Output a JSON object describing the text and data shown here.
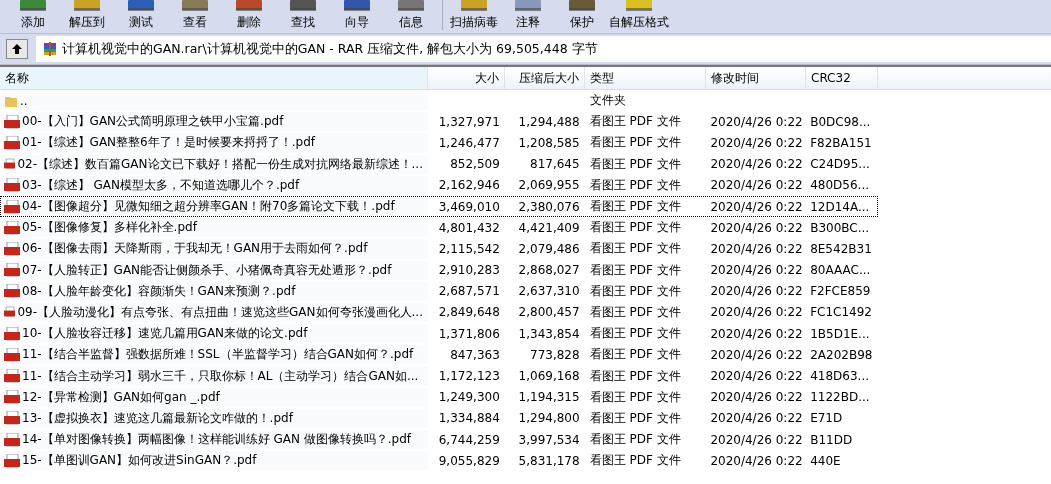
{
  "toolbar": [
    {
      "label": "添加",
      "kind": "add"
    },
    {
      "label": "解压到",
      "kind": "extract"
    },
    {
      "label": "测试",
      "kind": "test"
    },
    {
      "label": "查看",
      "kind": "view"
    },
    {
      "label": "删除",
      "kind": "delete"
    },
    {
      "label": "查找",
      "kind": "find"
    },
    {
      "label": "向导",
      "kind": "wizard"
    },
    {
      "label": "信息",
      "kind": "info"
    },
    {
      "label": "扫描病毒",
      "kind": "scan",
      "separator_before": true
    },
    {
      "label": "注释",
      "kind": "comment"
    },
    {
      "label": "保护",
      "kind": "protect"
    },
    {
      "label": "自解压格式",
      "kind": "sfx"
    }
  ],
  "address": {
    "path": "计算机视觉中的GAN.rar\\计算机视觉中的GAN - RAR 压缩文件, 解包大小为 69,505,448 字节"
  },
  "table": {
    "columns": [
      "名称",
      "大小",
      "压缩后大小",
      "类型",
      "修改时间",
      "CRC32"
    ],
    "rows": [
      {
        "kind": "folder",
        "name": "..",
        "size": "",
        "packed": "",
        "type": "文件夹",
        "modified": "",
        "crc": "",
        "focused": false
      },
      {
        "kind": "pdf",
        "name": "00-【入门】GAN公式简明原理之铁甲小宝篇.pdf",
        "size": "1,327,971",
        "packed": "1,294,488",
        "type": "看图王 PDF 文件",
        "modified": "2020/4/26 0:22",
        "crc": "B0DC98...",
        "focused": false
      },
      {
        "kind": "pdf",
        "name": "01-【综述】GAN整整6年了！是时候要来捋捋了！.pdf",
        "size": "1,246,477",
        "packed": "1,208,585",
        "type": "看图王 PDF 文件",
        "modified": "2020/4/26 0:22",
        "crc": "F82BA151",
        "focused": false
      },
      {
        "kind": "pdf",
        "name": "02-【综述】数百篇GAN论文已下载好！搭配一份生成对抗网络最新综述！...",
        "size": "852,509",
        "packed": "817,645",
        "type": "看图王 PDF 文件",
        "modified": "2020/4/26 0:22",
        "crc": "C24D95...",
        "focused": false
      },
      {
        "kind": "pdf",
        "name": "03-【综述】 GAN模型太多，不知道选哪儿个？.pdf",
        "size": "2,162,946",
        "packed": "2,069,955",
        "type": "看图王 PDF 文件",
        "modified": "2020/4/26 0:22",
        "crc": "480D56...",
        "focused": false
      },
      {
        "kind": "pdf",
        "name": "04-【图像超分】见微知细之超分辨率GAN！附70多篇论文下载！.pdf",
        "size": "3,469,010",
        "packed": "2,380,076",
        "type": "看图王 PDF 文件",
        "modified": "2020/4/26 0:22",
        "crc": "12D14A...",
        "focused": true
      },
      {
        "kind": "pdf",
        "name": "05-【图像修复】多样化补全.pdf",
        "size": "4,801,432",
        "packed": "4,421,409",
        "type": "看图王 PDF 文件",
        "modified": "2020/4/26 0:22",
        "crc": "B300BC...",
        "focused": false
      },
      {
        "kind": "pdf",
        "name": "06-【图像去雨】天降斯雨，于我却无！GAN用于去雨如何？.pdf",
        "size": "2,115,542",
        "packed": "2,079,486",
        "type": "看图王 PDF 文件",
        "modified": "2020/4/26 0:22",
        "crc": "8E542B31",
        "focused": false
      },
      {
        "kind": "pdf",
        "name": "07-【人脸转正】GAN能否让侧颜杀手、小猪佩奇真容无处遁形？.pdf",
        "size": "2,910,283",
        "packed": "2,868,027",
        "type": "看图王 PDF 文件",
        "modified": "2020/4/26 0:22",
        "crc": "80AAAC...",
        "focused": false
      },
      {
        "kind": "pdf",
        "name": "08-【人脸年龄变化】容颜渐失！GAN来预测？.pdf",
        "size": "2,687,571",
        "packed": "2,637,310",
        "type": "看图王 PDF 文件",
        "modified": "2020/4/26 0:22",
        "crc": "F2FCE859",
        "focused": false
      },
      {
        "kind": "pdf",
        "name": "09-【人脸动漫化】有点夸张、有点扭曲！速览这些GAN如何夸张漫画化人...",
        "size": "2,849,648",
        "packed": "2,800,457",
        "type": "看图王 PDF 文件",
        "modified": "2020/4/26 0:22",
        "crc": "FC1C1492",
        "focused": false
      },
      {
        "kind": "pdf",
        "name": "10-【人脸妆容迁移】速览几篇用GAN来做的论文.pdf",
        "size": "1,371,806",
        "packed": "1,343,854",
        "type": "看图王 PDF 文件",
        "modified": "2020/4/26 0:22",
        "crc": "1B5D1E...",
        "focused": false
      },
      {
        "kind": "pdf",
        "name": "11-【结合半监督】强数据所难！SSL（半监督学习）结合GAN如何？.pdf",
        "size": "847,363",
        "packed": "773,828",
        "type": "看图王 PDF 文件",
        "modified": "2020/4/26 0:22",
        "crc": "2A202B98",
        "focused": false
      },
      {
        "kind": "pdf",
        "name": "11-【结合主动学习】弱水三千，只取你标！AL（主动学习）结合GAN如...",
        "size": "1,172,123",
        "packed": "1,069,168",
        "type": "看图王 PDF 文件",
        "modified": "2020/4/26 0:22",
        "crc": "418D63...",
        "focused": false
      },
      {
        "kind": "pdf",
        "name": "12-【异常检测】GAN如何gan _.pdf",
        "size": "1,249,300",
        "packed": "1,194,315",
        "type": "看图王 PDF 文件",
        "modified": "2020/4/26 0:22",
        "crc": "1122BD...",
        "focused": false
      },
      {
        "kind": "pdf",
        "name": "13-【虚拟换衣】速览这几篇最新论文咋做的！.pdf",
        "size": "1,334,884",
        "packed": "1,294,800",
        "type": "看图王 PDF 文件",
        "modified": "2020/4/26 0:22",
        "crc": "E71D",
        "focused": false
      },
      {
        "kind": "pdf",
        "name": "14-【单对图像转换】两幅图像！这样能训练好 GAN 做图像转换吗？.pdf",
        "size": "6,744,259",
        "packed": "3,997,534",
        "type": "看图王 PDF 文件",
        "modified": "2020/4/26 0:22",
        "crc": "B11DD",
        "focused": false
      },
      {
        "kind": "pdf",
        "name": "15-【单图训GAN】如何改进SinGAN？.pdf",
        "size": "9,055,829",
        "packed": "5,831,178",
        "type": "看图王 PDF 文件",
        "modified": "2020/4/26 0:22",
        "crc": "440E",
        "focused": false
      }
    ]
  }
}
